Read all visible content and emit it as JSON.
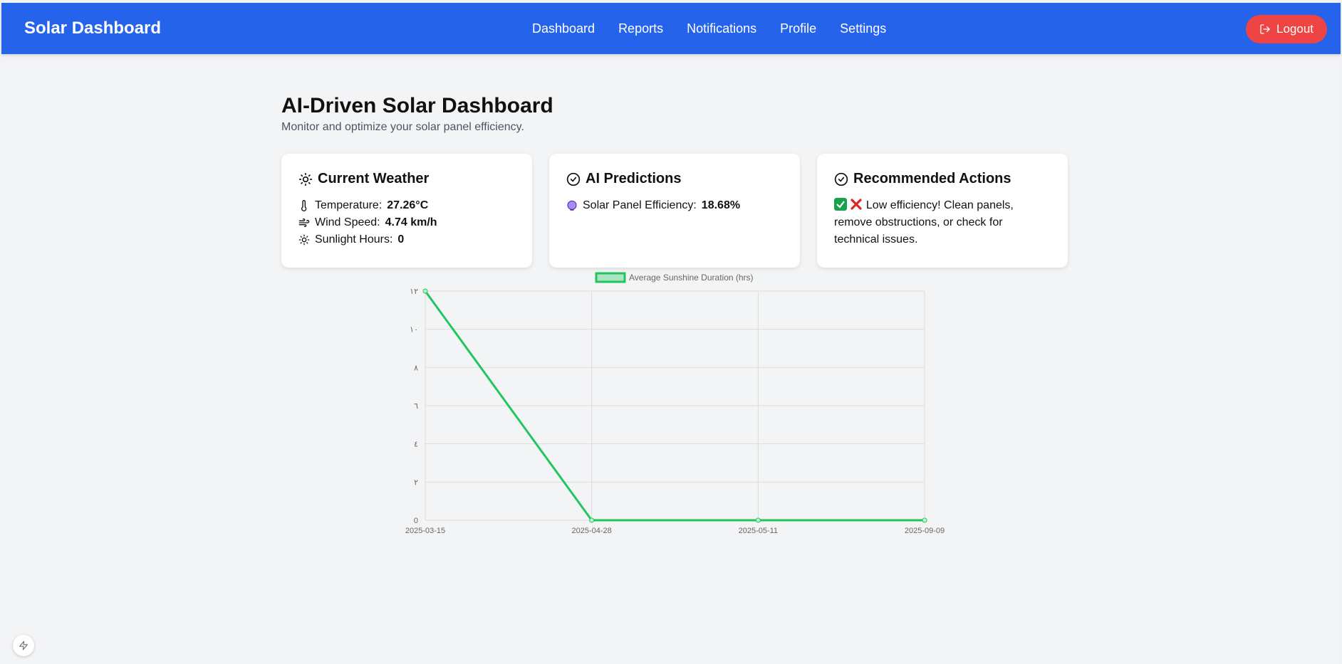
{
  "navbar": {
    "brand": "Solar Dashboard",
    "links": [
      "Dashboard",
      "Reports",
      "Notifications",
      "Profile",
      "Settings"
    ],
    "logout_label": "Logout"
  },
  "colors": {
    "primary": "#2563eb",
    "danger": "#ef4444",
    "series": "#22c55e"
  },
  "header": {
    "title": "AI-Driven Solar Dashboard",
    "subtitle": "Monitor and optimize your solar panel efficiency."
  },
  "weather": {
    "title": "Current Weather",
    "temperature_label": "Temperature:",
    "temperature_value": "27.26°C",
    "wind_label": "Wind Speed:",
    "wind_value": "4.74 km/h",
    "sunlight_label": "Sunlight Hours:",
    "sunlight_value": "0"
  },
  "predictions": {
    "title": "AI Predictions",
    "efficiency_label": "Solar Panel Efficiency:",
    "efficiency_value": "18.68%"
  },
  "actions": {
    "title": "Recommended Actions",
    "text_bold": "Low efficiency!",
    "text_rest": "Clean panels, remove obstructions, or check for technical issues."
  },
  "chart_data": {
    "type": "line",
    "x": [
      "2025-03-15",
      "2025-04-28",
      "2025-05-11",
      "2025-09-09"
    ],
    "series": [
      {
        "name": "Average Sunshine Duration (hrs)",
        "values": [
          12,
          0,
          0,
          0
        ]
      }
    ],
    "yticks": [
      "0",
      "٢",
      "٤",
      "٦",
      "٨",
      "١٠",
      "١٢"
    ],
    "ylim": [
      0,
      12
    ],
    "grid": true,
    "legend": "top"
  }
}
